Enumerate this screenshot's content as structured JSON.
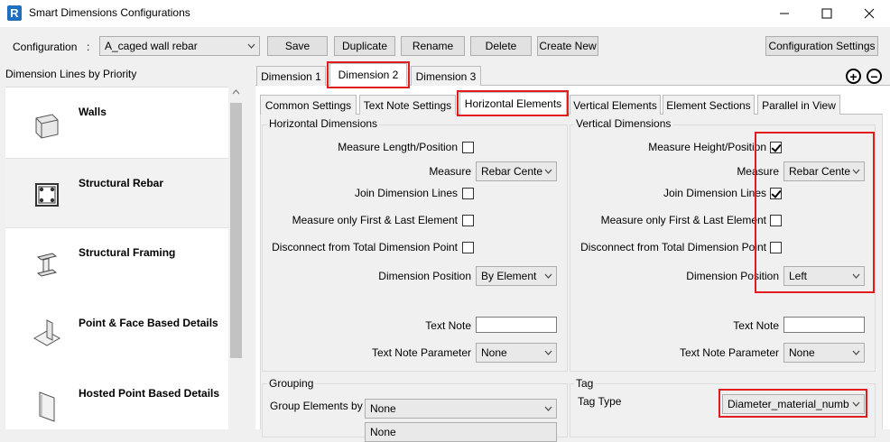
{
  "window": {
    "title": "Smart Dimensions Configurations",
    "logo": "R"
  },
  "toolbar": {
    "configuration_label": "Configuration",
    "colon": ":",
    "configuration_value": "A_caged wall rebar",
    "save": "Save",
    "duplicate": "Duplicate",
    "rename": "Rename",
    "delete": "Delete",
    "create_new": "Create New",
    "configuration_settings": "Configuration Settings"
  },
  "left_panel": {
    "title": "Dimension Lines by Priority",
    "items": [
      {
        "label": "Walls",
        "icon": "wall-icon"
      },
      {
        "label": "Structural Rebar",
        "icon": "rebar-icon"
      },
      {
        "label": "Structural Framing",
        "icon": "framing-icon"
      },
      {
        "label": "Point & Face Based Details",
        "icon": "face-detail-icon"
      },
      {
        "label": "Hosted Point Based Details",
        "icon": "hosted-detail-icon"
      }
    ]
  },
  "dimension_tabs": [
    "Dimension 1",
    "Dimension 2",
    "Dimension 3"
  ],
  "element_tabs": [
    "Common Settings",
    "Text Note Settings",
    "Horizontal Elements",
    "Vertical Elements",
    "Element Sections",
    "Parallel in View"
  ],
  "plus_minus": {
    "plus": "+",
    "minus": "−"
  },
  "horizontal": {
    "title": "Horizontal Dimensions",
    "measure_length": "Measure Length/Position",
    "measure_label": "Measure",
    "measure_value": "Rebar Cente",
    "join": "Join Dimension Lines",
    "first_last": "Measure only First & Last Element",
    "disconnect": "Disconnect from Total Dimension Point",
    "position_label": "Dimension Position",
    "position_value": "By Element",
    "text_note": "Text Note",
    "text_note_param": "Text Note Parameter",
    "text_note_param_value": "None"
  },
  "vertical": {
    "title": "Vertical Dimensions",
    "measure_height": "Measure Height/Position",
    "measure_label": "Measure",
    "measure_value": "Rebar Cente",
    "join": "Join Dimension Lines",
    "first_last": "Measure only First & Last Element",
    "disconnect": "Disconnect from Total Dimension Point",
    "position_label": "Dimension Position",
    "position_value": "Left",
    "text_note": "Text Note",
    "text_note_param": "Text Note Parameter",
    "text_note_param_value": "None"
  },
  "grouping": {
    "title": "Grouping",
    "group_by": "Group Elements by",
    "group_by_value": "None",
    "second_value": "None"
  },
  "tag": {
    "title": "Tag",
    "tag_type": "Tag Type",
    "tag_type_value": "Diameter_material_numb"
  }
}
